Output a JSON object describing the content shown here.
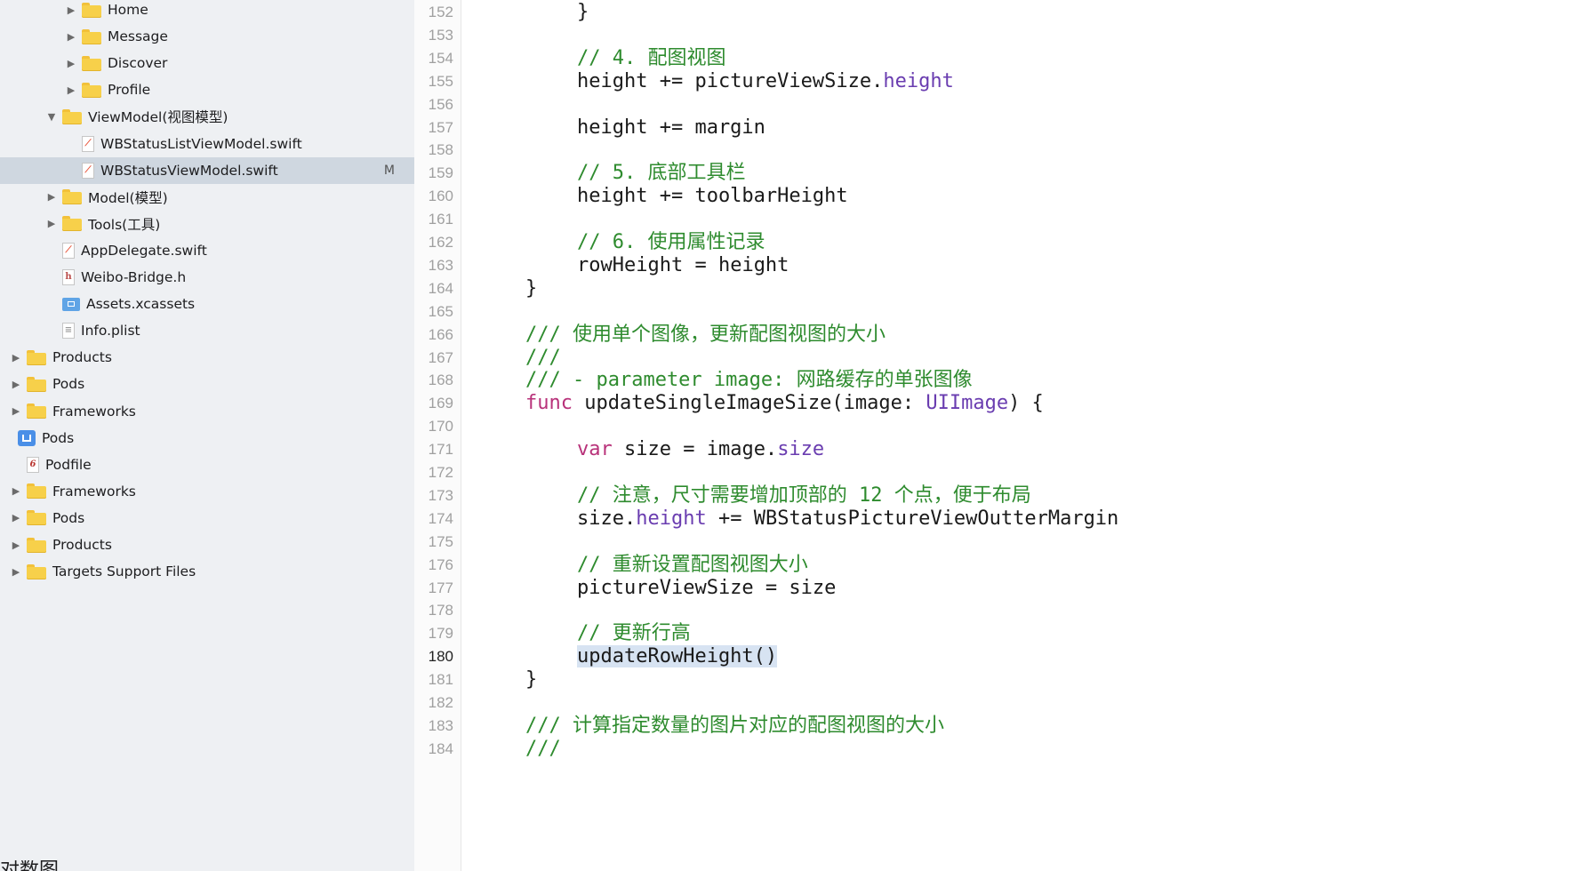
{
  "navigator": {
    "items": [
      {
        "label": "Home",
        "icon": "folder-icon",
        "disclosure": "collapsed",
        "level": 3
      },
      {
        "label": "Message",
        "icon": "folder-icon",
        "disclosure": "collapsed",
        "level": 3
      },
      {
        "label": "Discover",
        "icon": "folder-icon",
        "disclosure": "collapsed",
        "level": 3
      },
      {
        "label": "Profile",
        "icon": "folder-icon",
        "disclosure": "collapsed",
        "level": 3
      },
      {
        "label": "ViewModel(视图模型)",
        "icon": "folder-icon",
        "disclosure": "expanded",
        "level": 2
      },
      {
        "label": "WBStatusListViewModel.swift",
        "icon": "swift-file-icon",
        "disclosure": "none",
        "level": 3
      },
      {
        "label": "WBStatusViewModel.swift",
        "icon": "swift-file-icon",
        "disclosure": "none",
        "level": 3,
        "selected": true,
        "badge": "M"
      },
      {
        "label": "Model(模型)",
        "icon": "folder-icon",
        "disclosure": "collapsed",
        "level": 2
      },
      {
        "label": "Tools(工具)",
        "icon": "folder-icon",
        "disclosure": "collapsed",
        "level": 2
      },
      {
        "label": "AppDelegate.swift",
        "icon": "swift-file-icon",
        "disclosure": "none",
        "level": 2
      },
      {
        "label": "Weibo-Bridge.h",
        "icon": "header-file-icon",
        "disclosure": "none",
        "level": 2
      },
      {
        "label": "Assets.xcassets",
        "icon": "asset-catalog-icon",
        "disclosure": "none",
        "level": 2
      },
      {
        "label": "Info.plist",
        "icon": "plist-file-icon",
        "disclosure": "none",
        "level": 2
      },
      {
        "label": "Products",
        "icon": "folder-icon",
        "disclosure": "collapsed",
        "level": 1
      },
      {
        "label": "Pods",
        "icon": "folder-icon",
        "disclosure": "collapsed",
        "level": 1
      },
      {
        "label": "Frameworks",
        "icon": "folder-icon",
        "disclosure": "collapsed",
        "level": 1
      },
      {
        "label": "Pods",
        "icon": "project-icon",
        "disclosure": "none",
        "level": 0
      },
      {
        "label": "Podfile",
        "icon": "podfile-icon",
        "disclosure": "none",
        "level": 1
      },
      {
        "label": "Frameworks",
        "icon": "folder-icon",
        "disclosure": "collapsed",
        "level": 1
      },
      {
        "label": "Pods",
        "icon": "folder-icon",
        "disclosure": "collapsed",
        "level": 1
      },
      {
        "label": "Products",
        "icon": "folder-icon",
        "disclosure": "collapsed",
        "level": 1
      },
      {
        "label": "Targets Support Files",
        "icon": "folder-icon",
        "disclosure": "collapsed",
        "level": 1
      }
    ],
    "bottom_fragment": "对数图"
  },
  "colors": {
    "comment": "#2e8b2e",
    "keyword": "#b8327a",
    "type": "#6a3db0",
    "property": "#2f8a9e",
    "plain": "#1a1a1a",
    "selection": "#d7e3f2"
  },
  "editor": {
    "active_line": 180,
    "lines": [
      {
        "num": 152,
        "indent": 2,
        "tokens": [
          {
            "t": "}",
            "c": "plain"
          }
        ]
      },
      {
        "num": 153,
        "indent": 0,
        "tokens": []
      },
      {
        "num": 154,
        "indent": 2,
        "tokens": [
          {
            "t": "// 4. 配图视图",
            "c": "comment"
          }
        ]
      },
      {
        "num": 155,
        "indent": 2,
        "tokens": [
          {
            "t": "height += ",
            "c": "plain"
          },
          {
            "t": "pictureViewSize",
            "c": "property"
          },
          {
            "t": ".",
            "c": "plain"
          },
          {
            "t": "height",
            "c": "member"
          }
        ]
      },
      {
        "num": 156,
        "indent": 0,
        "tokens": []
      },
      {
        "num": 157,
        "indent": 2,
        "tokens": [
          {
            "t": "height += margin",
            "c": "plain"
          }
        ]
      },
      {
        "num": 158,
        "indent": 0,
        "tokens": []
      },
      {
        "num": 159,
        "indent": 2,
        "tokens": [
          {
            "t": "// 5. 底部工具栏",
            "c": "comment"
          }
        ]
      },
      {
        "num": 160,
        "indent": 2,
        "tokens": [
          {
            "t": "height += toolbarHeight",
            "c": "plain"
          }
        ]
      },
      {
        "num": 161,
        "indent": 0,
        "tokens": []
      },
      {
        "num": 162,
        "indent": 2,
        "tokens": [
          {
            "t": "// 6. 使用属性记录",
            "c": "comment"
          }
        ]
      },
      {
        "num": 163,
        "indent": 2,
        "tokens": [
          {
            "t": "rowHeight",
            "c": "property"
          },
          {
            "t": " = height",
            "c": "plain"
          }
        ]
      },
      {
        "num": 164,
        "indent": 1,
        "tokens": [
          {
            "t": "}",
            "c": "plain"
          }
        ]
      },
      {
        "num": 165,
        "indent": 0,
        "tokens": []
      },
      {
        "num": 166,
        "indent": 1,
        "tokens": [
          {
            "t": "/// 使用单个图像，更新配图视图的大小",
            "c": "comment"
          }
        ]
      },
      {
        "num": 167,
        "indent": 1,
        "tokens": [
          {
            "t": "///",
            "c": "comment"
          }
        ]
      },
      {
        "num": 168,
        "indent": 1,
        "tokens": [
          {
            "t": "/// - parameter image: 网路缓存的单张图像",
            "c": "comment"
          }
        ]
      },
      {
        "num": 169,
        "indent": 1,
        "tokens": [
          {
            "t": "func",
            "c": "keyword"
          },
          {
            "t": " updateSingleImageSize(image: ",
            "c": "plain"
          },
          {
            "t": "UIImage",
            "c": "type"
          },
          {
            "t": ") {",
            "c": "plain"
          }
        ]
      },
      {
        "num": 170,
        "indent": 0,
        "tokens": []
      },
      {
        "num": 171,
        "indent": 2,
        "tokens": [
          {
            "t": "var",
            "c": "keyword"
          },
          {
            "t": " size = image.",
            "c": "plain"
          },
          {
            "t": "size",
            "c": "member"
          }
        ]
      },
      {
        "num": 172,
        "indent": 0,
        "tokens": []
      },
      {
        "num": 173,
        "indent": 2,
        "tokens": [
          {
            "t": "// 注意，尺寸需要增加顶部的 12 个点，便于布局",
            "c": "comment"
          }
        ]
      },
      {
        "num": 174,
        "indent": 2,
        "tokens": [
          {
            "t": "size.",
            "c": "plain"
          },
          {
            "t": "height",
            "c": "member"
          },
          {
            "t": " += ",
            "c": "plain"
          },
          {
            "t": "WBStatusPictureViewOutterMargin",
            "c": "property"
          }
        ]
      },
      {
        "num": 175,
        "indent": 0,
        "tokens": []
      },
      {
        "num": 176,
        "indent": 2,
        "tokens": [
          {
            "t": "// 重新设置配图视图大小",
            "c": "comment"
          }
        ]
      },
      {
        "num": 177,
        "indent": 2,
        "tokens": [
          {
            "t": "pictureViewSize",
            "c": "property"
          },
          {
            "t": " = size",
            "c": "plain"
          }
        ]
      },
      {
        "num": 178,
        "indent": 0,
        "tokens": []
      },
      {
        "num": 179,
        "indent": 2,
        "tokens": [
          {
            "t": "// 更新行高",
            "c": "comment"
          }
        ]
      },
      {
        "num": 180,
        "indent": 2,
        "tokens": [
          {
            "t": "updateRowHeight()",
            "c": "plain",
            "selected": true
          }
        ]
      },
      {
        "num": 181,
        "indent": 1,
        "tokens": [
          {
            "t": "}",
            "c": "plain"
          }
        ]
      },
      {
        "num": 182,
        "indent": 0,
        "tokens": []
      },
      {
        "num": 183,
        "indent": 1,
        "tokens": [
          {
            "t": "/// 计算指定数量的图片对应的配图视图的大小",
            "c": "comment"
          }
        ]
      },
      {
        "num": 184,
        "indent": 1,
        "tokens": [
          {
            "t": "///",
            "c": "comment"
          }
        ]
      }
    ]
  }
}
